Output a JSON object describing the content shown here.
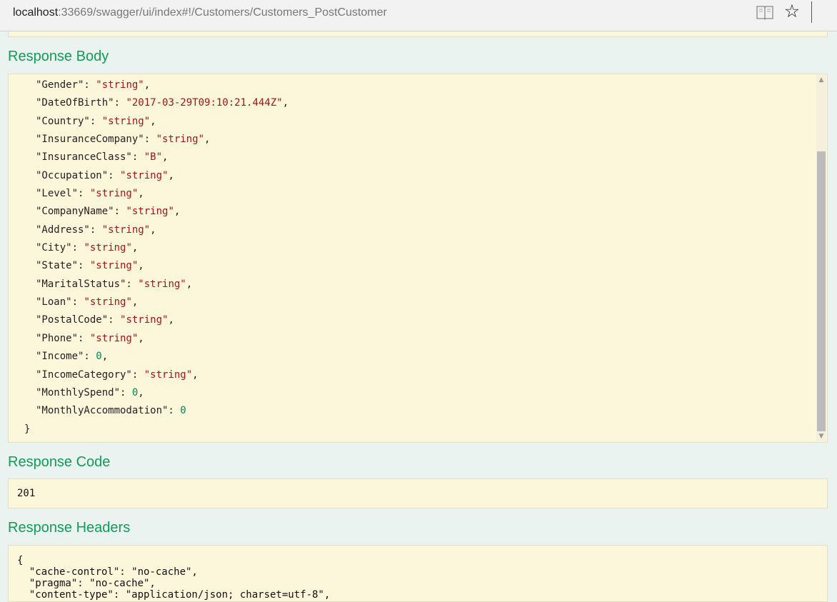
{
  "browser": {
    "url_host": "localhost",
    "url_rest": ":33669/swagger/ui/index#!/Customers/Customers_PostCustomer",
    "reading_view_icon": "book-icon",
    "favorite_icon": "star-icon"
  },
  "response_body": {
    "heading": "Response Body",
    "lines": [
      {
        "key": "\"Gender\": ",
        "value": "\"string\"",
        "type": "s",
        "trail": ","
      },
      {
        "key": "\"DateOfBirth\": ",
        "value": "\"2017-03-29T09:10:21.444Z\"",
        "type": "s",
        "trail": ","
      },
      {
        "key": "\"Country\": ",
        "value": "\"string\"",
        "type": "s",
        "trail": ","
      },
      {
        "key": "\"InsuranceCompany\": ",
        "value": "\"string\"",
        "type": "s",
        "trail": ","
      },
      {
        "key": "\"InsuranceClass\": ",
        "value": "\"B\"",
        "type": "s",
        "trail": ","
      },
      {
        "key": "\"Occupation\": ",
        "value": "\"string\"",
        "type": "s",
        "trail": ","
      },
      {
        "key": "\"Level\": ",
        "value": "\"string\"",
        "type": "s",
        "trail": ","
      },
      {
        "key": "\"CompanyName\": ",
        "value": "\"string\"",
        "type": "s",
        "trail": ","
      },
      {
        "key": "\"Address\": ",
        "value": "\"string\"",
        "type": "s",
        "trail": ","
      },
      {
        "key": "\"City\": ",
        "value": "\"string\"",
        "type": "s",
        "trail": ","
      },
      {
        "key": "\"State\": ",
        "value": "\"string\"",
        "type": "s",
        "trail": ","
      },
      {
        "key": "\"MaritalStatus\": ",
        "value": "\"string\"",
        "type": "s",
        "trail": ","
      },
      {
        "key": "\"Loan\": ",
        "value": "\"string\"",
        "type": "s",
        "trail": ","
      },
      {
        "key": "\"PostalCode\": ",
        "value": "\"string\"",
        "type": "s",
        "trail": ","
      },
      {
        "key": "\"Phone\": ",
        "value": "\"string\"",
        "type": "s",
        "trail": ","
      },
      {
        "key": "\"Income\": ",
        "value": "0",
        "type": "n",
        "trail": ","
      },
      {
        "key": "\"IncomeCategory\": ",
        "value": "\"string\"",
        "type": "s",
        "trail": ","
      },
      {
        "key": "\"MonthlySpend\": ",
        "value": "0",
        "type": "n",
        "trail": ","
      },
      {
        "key": "\"MonthlyAccommodation\": ",
        "value": "0",
        "type": "n",
        "trail": ""
      }
    ],
    "closing": "}"
  },
  "response_code": {
    "heading": "Response Code",
    "value": "201"
  },
  "response_headers": {
    "heading": "Response Headers",
    "text": "{\n  \"cache-control\": \"no-cache\",\n  \"pragma\": \"no-cache\",\n  \"content-type\": \"application/json; charset=utf-8\","
  },
  "colors": {
    "heading": "#0f9d58",
    "string_value": "#a31515",
    "number_value": "#098658",
    "box_background": "#fcf6db"
  }
}
